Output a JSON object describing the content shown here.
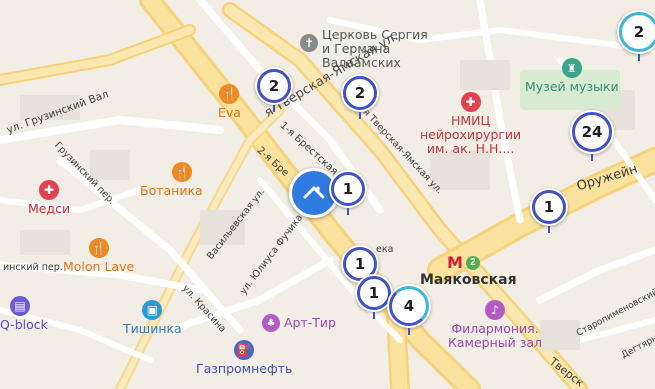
{
  "labels": {
    "church": [
      "Церковь Сергия",
      "и Германа",
      "Валаамских"
    ],
    "music": "Музей музыки",
    "nmic": [
      "НМИЦ",
      "нейрохирургии",
      "им. ак. Н.Н...."
    ],
    "eva": "Eva",
    "botanika": "Ботаника",
    "medsi": "Медси",
    "molon": "Molon Lave",
    "tishinka": "Тишинка",
    "qblock": "Q-block",
    "arttir": "Арт-Тир",
    "gazprom": "Газпромнефть",
    "filarmonia": [
      "Филармония.",
      "Камерный зал"
    ],
    "metro_station": "Маяковская",
    "metro_line": "2",
    "street_1": "я Тверская-Ямская ул.",
    "street_2": "1-я Тверская-Ямская ул.",
    "street_3": "1-я Брестская",
    "street_4": "2-я Бре",
    "street_5": "ул. Грузинский Вал",
    "street_6": "Грузинский пер.",
    "street_7": "Васильевская ул.",
    "street_8": "ул. Юлиуса Фучика",
    "street_9": "ул. Красина",
    "street_10": "инский пер.",
    "street_11": "Оружейн",
    "street_12": "Старопименовский",
    "street_13": "Дегтярн",
    "street_14": "Тверск",
    "street_15": "ека"
  },
  "clusters": [
    {
      "id": "c1",
      "count": "2"
    },
    {
      "id": "c2",
      "count": "2"
    },
    {
      "id": "c3",
      "count": "1"
    },
    {
      "id": "c4",
      "count": "1"
    },
    {
      "id": "c5",
      "count": "1"
    },
    {
      "id": "c6",
      "count": "4"
    },
    {
      "id": "c7",
      "count": "24"
    },
    {
      "id": "c8",
      "count": "1"
    },
    {
      "id": "c9",
      "count": "2"
    }
  ],
  "colors": {
    "cluster_ring": "#3f52c8",
    "selected_pin": "#2f7be2",
    "metro": "#d6202e",
    "metro_line2": "#4caf50",
    "food_poi": "#f08a1c",
    "medical_poi": "#e2414f",
    "park_poi": "#3aa68a",
    "culture_poi": "#b35cc8"
  }
}
